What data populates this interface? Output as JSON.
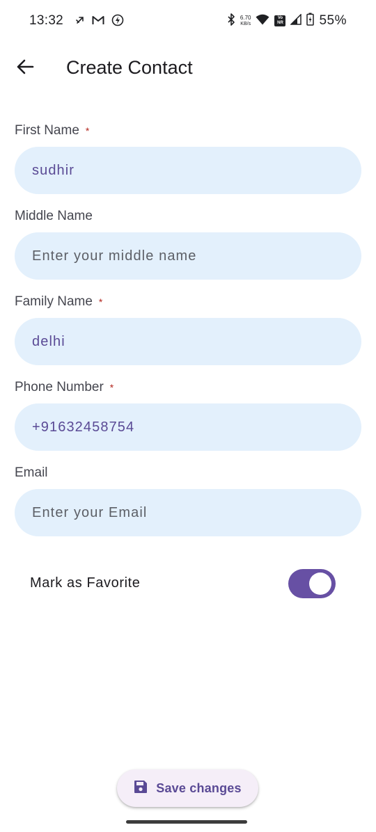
{
  "status_bar": {
    "time": "13:32",
    "net_speed_value": "6.70",
    "net_speed_unit": "KB/s",
    "volte_top": "Vo",
    "volte_bottom": "NR",
    "battery_percent": "55%",
    "left_icons": [
      "airplane-silent-icon",
      "gmail-icon",
      "data-saver-icon"
    ],
    "right_icons": [
      "bluetooth-icon",
      "wifi-icon",
      "signal-icon",
      "battery-charging-icon"
    ]
  },
  "app_bar": {
    "title": "Create Contact",
    "back_icon": "arrow-back-icon"
  },
  "form": {
    "first_name": {
      "label": "First Name",
      "required": true,
      "value": "sudhir",
      "placeholder": ""
    },
    "middle_name": {
      "label": "Middle Name",
      "required": false,
      "value": "",
      "placeholder": "Enter your middle name"
    },
    "family_name": {
      "label": "Family Name",
      "required": true,
      "value": "delhi",
      "placeholder": ""
    },
    "phone_number": {
      "label": "Phone Number",
      "required": true,
      "value": "+91632458754",
      "placeholder": ""
    },
    "email": {
      "label": "Email",
      "required": false,
      "value": "",
      "placeholder": "Enter your Email"
    },
    "required_marker": "*"
  },
  "favorite": {
    "label": "Mark as Favorite",
    "enabled": true
  },
  "save_button": {
    "label": "Save changes",
    "icon": "save-icon"
  },
  "colors": {
    "accent": "#6750a4",
    "input_background": "#e3f0fc",
    "required": "#b3261e",
    "input_text": "#5a4a95"
  }
}
